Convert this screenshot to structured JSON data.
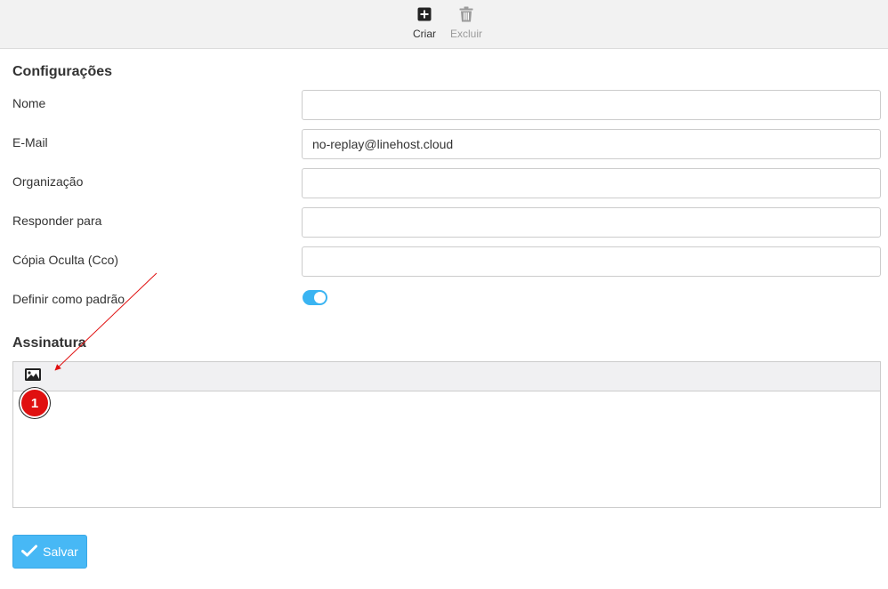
{
  "toolbar": {
    "create_label": "Criar",
    "delete_label": "Excluir"
  },
  "settings": {
    "title": "Configurações",
    "fields": [
      {
        "label": "Nome",
        "value": ""
      },
      {
        "label": "E-Mail",
        "value": "no-replay@linehost.cloud"
      },
      {
        "label": "Organização",
        "value": ""
      },
      {
        "label": "Responder para",
        "value": ""
      },
      {
        "label": "Cópia Oculta (Cco)",
        "value": ""
      }
    ],
    "default_label": "Definir como padrão",
    "default_enabled": true
  },
  "signature": {
    "title": "Assinatura",
    "content": ""
  },
  "annotation": {
    "marker": "1",
    "color": "#e01010"
  },
  "actions": {
    "save_label": "Salvar"
  },
  "colors": {
    "accent": "#47b8f5",
    "toggle_on": "#3ab4f2"
  }
}
